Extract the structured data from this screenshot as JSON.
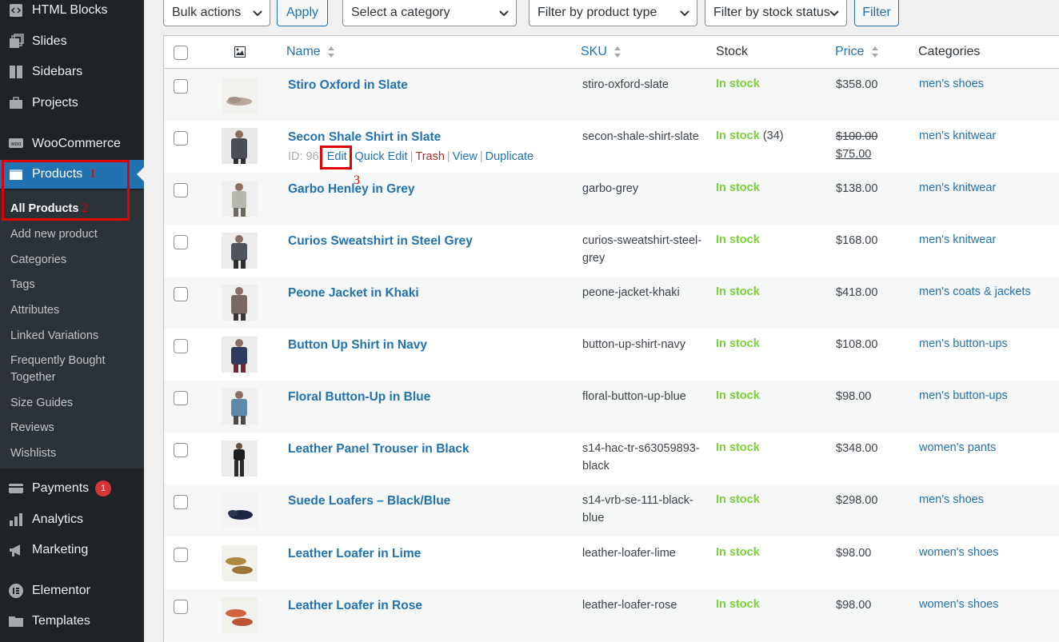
{
  "sidebar": {
    "menu": [
      {
        "label": "HTML Blocks",
        "icon": "code-icon"
      },
      {
        "label": "Slides",
        "icon": "slides-icon"
      },
      {
        "label": "Sidebars",
        "icon": "sidebars-icon"
      },
      {
        "label": "Projects",
        "icon": "briefcase-icon"
      },
      {
        "label": "WooCommerce",
        "icon": "woo-icon"
      },
      {
        "label": "Products",
        "icon": "products-icon"
      },
      {
        "label": "Payments",
        "icon": "payments-icon",
        "badge": "1"
      },
      {
        "label": "Analytics",
        "icon": "analytics-icon"
      },
      {
        "label": "Marketing",
        "icon": "megaphone-icon"
      },
      {
        "label": "Elementor",
        "icon": "elementor-icon"
      },
      {
        "label": "Templates",
        "icon": "folder-icon"
      }
    ],
    "submenu": [
      "All Products",
      "Add new product",
      "Categories",
      "Tags",
      "Attributes",
      "Linked Variations",
      "Frequently Bought Together",
      "Size Guides",
      "Reviews",
      "Wishlists"
    ]
  },
  "annotations": {
    "n1": "1",
    "n2": "2",
    "n3": "3"
  },
  "toolbar": {
    "bulk_actions": "Bulk actions",
    "apply": "Apply",
    "category": "Select a category",
    "product_type": "Filter by product type",
    "stock_status": "Filter by stock status",
    "filter": "Filter"
  },
  "table": {
    "headers": {
      "name": "Name",
      "sku": "SKU",
      "stock": "Stock",
      "price": "Price",
      "categories": "Categories"
    },
    "rows": [
      {
        "name": "Stiro Oxford in Slate",
        "sku": "stiro-oxford-slate",
        "stock": "In stock",
        "stock_count": "",
        "price": "$358.00",
        "category": "men's shoes"
      },
      {
        "name": "Secon Shale Shirt in Slate",
        "sku": "secon-shale-shirt-slate",
        "stock": "In stock",
        "stock_count": "(34)",
        "price_old": "$100.00",
        "price": "$75.00",
        "category": "men's knitwear"
      },
      {
        "name": "Garbo Henley in Grey",
        "sku": "garbo-grey",
        "stock": "In stock",
        "stock_count": "",
        "price": "$138.00",
        "category": "men's knitwear"
      },
      {
        "name": "Curios Sweatshirt in Steel Grey",
        "sku": "curios-sweatshirt-steel-grey",
        "stock": "In stock",
        "stock_count": "",
        "price": "$168.00",
        "category": "men's knitwear"
      },
      {
        "name": "Peone Jacket in Khaki",
        "sku": "peone-jacket-khaki",
        "stock": "In stock",
        "stock_count": "",
        "price": "$418.00",
        "category": "men's coats & jackets"
      },
      {
        "name": "Button Up Shirt in Navy",
        "sku": "button-up-shirt-navy",
        "stock": "In stock",
        "stock_count": "",
        "price": "$108.00",
        "category": "men's button-ups"
      },
      {
        "name": "Floral Button-Up in Blue",
        "sku": "floral-button-up-blue",
        "stock": "In stock",
        "stock_count": "",
        "price": "$98.00",
        "category": "men's button-ups"
      },
      {
        "name": "Leather Panel Trouser in Black",
        "sku": "s14-hac-tr-s63059893-black",
        "stock": "In stock",
        "stock_count": "",
        "price": "$348.00",
        "category": "women's pants"
      },
      {
        "name": "Suede Loafers – Black/Blue",
        "sku": "s14-vrb-se-111-black-blue",
        "stock": "In stock",
        "stock_count": "",
        "price": "$298.00",
        "category": "men's shoes"
      },
      {
        "name": "Leather Loafer in Lime",
        "sku": "leather-loafer-lime",
        "stock": "In stock",
        "stock_count": "",
        "price": "$98.00",
        "category": "women's shoes"
      },
      {
        "name": "Leather Loafer in Rose",
        "sku": "leather-loafer-rose",
        "stock": "In stock",
        "stock_count": "",
        "price": "$98.00",
        "category": "women's shoes"
      }
    ],
    "row_actions": {
      "id": "ID: 96",
      "edit": "Edit",
      "quick_edit": "Quick Edit",
      "trash": "Trash",
      "view": "View",
      "duplicate": "Duplicate",
      "sep": "|"
    }
  },
  "colors": {
    "accent": "#2271b1",
    "in_stock": "#7ad03a",
    "sidebar_bg": "#1d2327",
    "annotation": "#e00000"
  }
}
